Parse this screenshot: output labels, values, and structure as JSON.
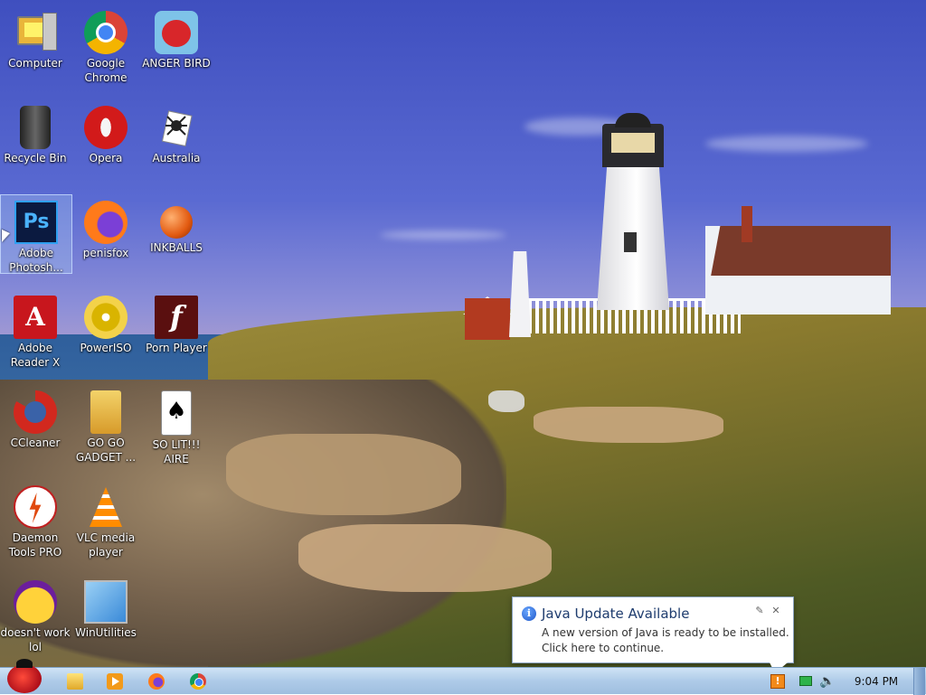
{
  "desktop": {
    "icons": [
      {
        "label": "Computer",
        "icon": "computer-icon"
      },
      {
        "label": "Google Chrome",
        "icon": "chrome-icon"
      },
      {
        "label": "ANGER BIRD",
        "icon": "angry-bird-icon"
      },
      {
        "label": "Recycle Bin",
        "icon": "recycle-bin-icon"
      },
      {
        "label": "Opera",
        "icon": "opera-icon"
      },
      {
        "label": "Australia",
        "icon": "spider-solitaire-icon"
      },
      {
        "label": "Adobe Photosh...",
        "icon": "photoshop-icon",
        "selected": true
      },
      {
        "label": "penisfox",
        "icon": "firefox-icon"
      },
      {
        "label": "INKBALLS",
        "icon": "inkball-icon"
      },
      {
        "label": "Adobe Reader X",
        "icon": "adobe-reader-icon"
      },
      {
        "label": "PowerISO",
        "icon": "poweriso-icon"
      },
      {
        "label": "Porn Player",
        "icon": "flash-player-icon"
      },
      {
        "label": "CCleaner",
        "icon": "ccleaner-icon"
      },
      {
        "label": "GO GO GADGET ...",
        "icon": "folder-icon"
      },
      {
        "label": "SO LIT!!! AIRE",
        "icon": "solitaire-icon"
      },
      {
        "label": "Daemon Tools PRO",
        "icon": "daemon-tools-icon"
      },
      {
        "label": "VLC media player",
        "icon": "vlc-icon"
      },
      {
        "label": "doesn't work lol",
        "icon": "yahoo-messenger-icon"
      },
      {
        "label": "WinUtilities",
        "icon": "winutilities-icon"
      }
    ]
  },
  "java_popup": {
    "title": "Java Update Available",
    "line1": "A new version of Java is ready to be installed.",
    "line2": "Click here to continue.",
    "info_glyph": "i",
    "options_glyph": "✎",
    "close_glyph": "✕"
  },
  "taskbar": {
    "pinned": [
      "folder-icon",
      "media-player-icon",
      "firefox-icon",
      "chrome-icon"
    ],
    "clock": "9:04 PM",
    "volume_glyph": "🔈"
  }
}
